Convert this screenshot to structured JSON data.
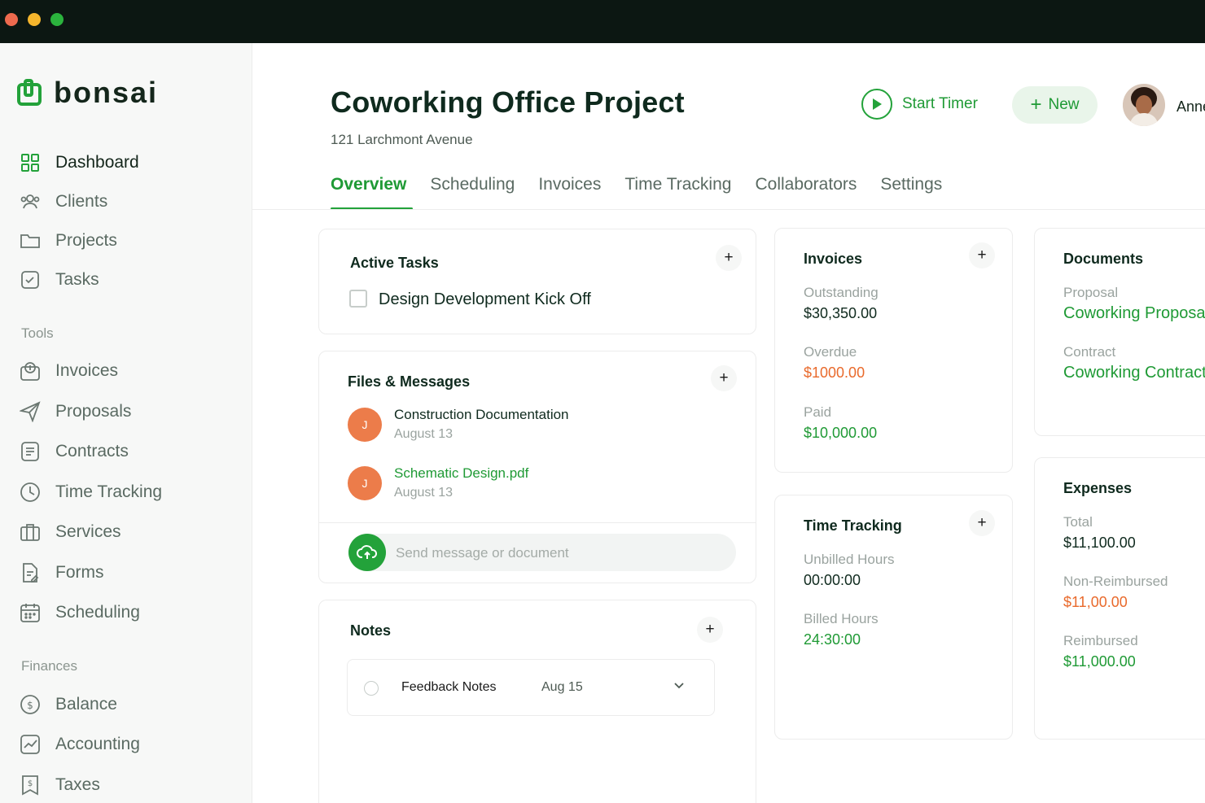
{
  "brand": {
    "name": "bonsai",
    "accent": "#23a23a"
  },
  "window_controls": [
    {
      "name": "close",
      "color": "#ee6a4e"
    },
    {
      "name": "minimize",
      "color": "#f5b52c"
    },
    {
      "name": "maximize",
      "color": "#2bb33d"
    }
  ],
  "sidebar": {
    "main_items": [
      {
        "label": "Dashboard",
        "icon": "grid-icon"
      },
      {
        "label": "Clients",
        "icon": "users-icon"
      },
      {
        "label": "Projects",
        "icon": "folder-icon"
      },
      {
        "label": "Tasks",
        "icon": "checkbox-icon"
      }
    ],
    "tools_label": "Tools",
    "tools_items": [
      {
        "label": "Invoices",
        "icon": "invoice-icon"
      },
      {
        "label": "Proposals",
        "icon": "paper-plane-icon"
      },
      {
        "label": "Contracts",
        "icon": "contract-icon"
      },
      {
        "label": "Time Tracking",
        "icon": "clock-icon"
      },
      {
        "label": "Services",
        "icon": "services-icon"
      },
      {
        "label": "Forms",
        "icon": "form-icon"
      },
      {
        "label": "Scheduling",
        "icon": "calendar-icon"
      }
    ],
    "finances_label": "Finances",
    "finances_items": [
      {
        "label": "Balance",
        "icon": "dollar-circle-icon"
      },
      {
        "label": "Accounting",
        "icon": "chart-icon"
      },
      {
        "label": "Taxes",
        "icon": "tax-icon"
      }
    ]
  },
  "header": {
    "title": "Coworking Office Project",
    "subtitle": "121 Larchmont Avenue",
    "start_timer_label": "Start Timer",
    "new_label": "New",
    "user_name": "Anne"
  },
  "tabs": [
    "Overview",
    "Scheduling",
    "Invoices",
    "Time Tracking",
    "Collaborators",
    "Settings"
  ],
  "active_tasks": {
    "title": "Active Tasks",
    "add_label": "+",
    "tasks": [
      {
        "label": "Design Development Kick Off"
      }
    ]
  },
  "files_messages": {
    "title": "Files & Messages",
    "add_label": "+",
    "items": [
      {
        "initial": "J",
        "title": "Construction Documentation",
        "date": "August 13"
      },
      {
        "initial": "J",
        "title": "Schematic Design.pdf",
        "date": "August 13"
      }
    ],
    "composer_placeholder": "Send message or document"
  },
  "notes": {
    "title": "Notes",
    "add_label": "+",
    "items": [
      {
        "title": "Feedback Notes",
        "date": "Aug 15"
      }
    ]
  },
  "invoices": {
    "title": "Invoices",
    "add_label": "+",
    "stats": [
      {
        "label": "Outstanding",
        "value": "$30,350.00"
      },
      {
        "label": "Overdue",
        "value": "$1000.00"
      },
      {
        "label": "Paid",
        "value": "$10,000.00"
      }
    ]
  },
  "time_tracking": {
    "title": "Time Tracking",
    "add_label": "+",
    "stats": [
      {
        "label": "Unbilled Hours",
        "value": "00:00:00"
      },
      {
        "label": "Billed Hours",
        "value": "24:30:00"
      }
    ]
  },
  "documents": {
    "title": "Documents",
    "items": [
      {
        "label": "Proposal",
        "value": "Coworking Proposal"
      },
      {
        "label": "Contract",
        "value": "Coworking Contract"
      }
    ]
  },
  "expenses": {
    "title": "Expenses",
    "stats": [
      {
        "label": "Total",
        "value": "$11,100.00"
      },
      {
        "label": "Non-Reimbursed",
        "value": "$11,00.00"
      },
      {
        "label": "Reimbursed",
        "value": "$11,000.00"
      }
    ]
  }
}
